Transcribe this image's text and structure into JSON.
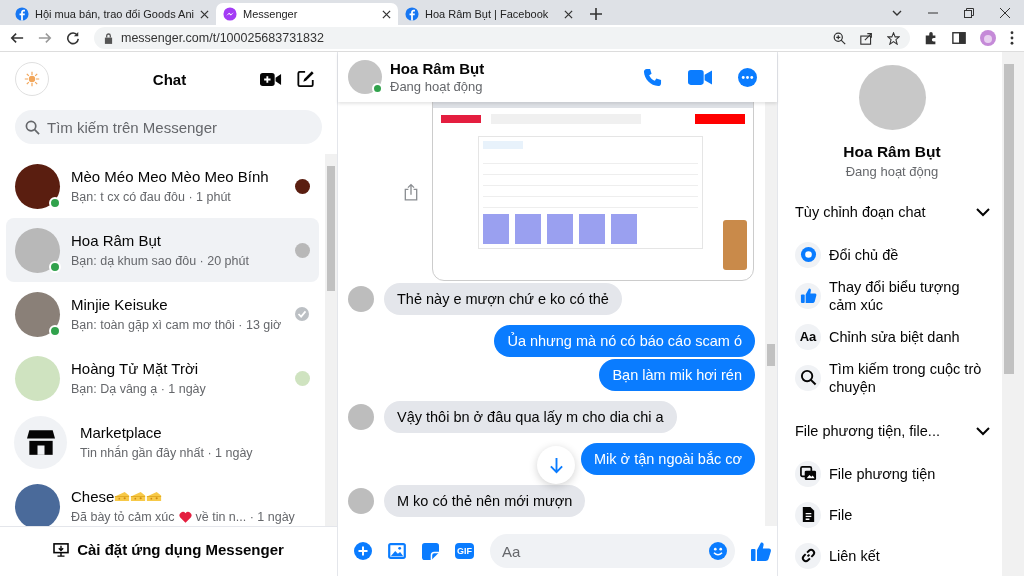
{
  "browser": {
    "tabs": [
      {
        "title": "Hội mua bán, trao đổi Goods Ani",
        "kind": "facebook",
        "selected": false
      },
      {
        "title": "Messenger",
        "kind": "messenger",
        "selected": true
      },
      {
        "title": "Hoa Râm Bụt | Facebook",
        "kind": "facebook",
        "selected": false
      }
    ],
    "address": "messenger.com/t/100025683731832"
  },
  "sidebar": {
    "title": "Chat",
    "search": {
      "placeholder": "Tìm kiếm trên Messenger"
    },
    "conversations": [
      {
        "kind": "person",
        "name": "Mèo Méo Meo Mèo Meo Bính",
        "snippet": "Bạn: t cx có đau đôu · 1 phút",
        "online": true,
        "selected": false,
        "receipt": {
          "kind": "avatar"
        },
        "color": "#5a1e10"
      },
      {
        "kind": "person",
        "name": "Hoa Râm Bụt",
        "snippet": "Bạn: dạ khum sao đôu · 20 phút",
        "online": true,
        "selected": true,
        "receipt": {
          "kind": "avatar"
        },
        "color": "#b8b8b8"
      },
      {
        "kind": "person",
        "name": "Minjie Keisuke",
        "snippet": "Bạn: toàn gặp xì cam mơ thôi · 13 giờ",
        "online": true,
        "selected": false,
        "receipt": {
          "kind": "check"
        },
        "color": "#8a8078"
      },
      {
        "kind": "person",
        "name": "Hoàng Tử Mặt Trời",
        "snippet": "Bạn: Dạ vâng ạ · 1 ngày",
        "online": false,
        "selected": false,
        "receipt": {
          "kind": "avatar"
        },
        "color": "#cfe3c0"
      },
      {
        "kind": "marketplace",
        "name": "Marketplace",
        "snippet": "Tin nhắn gần đây nhất · 1 ngày",
        "online": false,
        "selected": false
      },
      {
        "kind": "reaction",
        "name": "Chese",
        "snippet_start": "Đã bày tỏ cảm xúc",
        "snippet_end": "về tin n... · 1 ngày",
        "online": false,
        "selected": false,
        "color": "#4a6a9a"
      }
    ],
    "footer": "Cài đặt ứng dụng Messenger"
  },
  "chat": {
    "name": "Hoa Râm Bụt",
    "status": "Đang hoạt động",
    "online": true,
    "messages": [
      {
        "kind": "image"
      },
      {
        "kind": "incoming",
        "text": "Thẻ này e mượn chứ e ko có thẻ"
      },
      {
        "kind": "outgoing",
        "text": "Ủa nhưng mà nó có báo cáo scam ó"
      },
      {
        "kind": "outgoing",
        "text": "Bạn làm mik hơi rén"
      },
      {
        "kind": "incoming",
        "text": "Vậy thôi bn ở đâu qua lấy m cho dia chi a"
      },
      {
        "kind": "outgoing",
        "text": "Mik ở tận ngoài bắc cơ"
      },
      {
        "kind": "incoming",
        "text": "M ko có thẻ nên mới mượn"
      }
    ],
    "composer": {
      "placeholder": "Aa",
      "gif_label": "GIF"
    }
  },
  "details": {
    "name": "Hoa Râm Bụt",
    "status": "Đang hoạt động",
    "sections": [
      {
        "title": "Tùy chỉnh đoạn chat",
        "expanded": true,
        "items": [
          {
            "kind": "theme",
            "label": "Đổi chủ đề"
          },
          {
            "kind": "like",
            "label": "Thay đổi biểu tượng cảm xúc"
          },
          {
            "kind": "text",
            "icon_text": "Aa",
            "label": "Chỉnh sửa biệt danh"
          },
          {
            "kind": "search",
            "label": "Tìm kiếm trong cuộc trò chuyện"
          }
        ]
      },
      {
        "title": "File phương tiện, file...",
        "expanded": true,
        "items": [
          {
            "kind": "media",
            "label": "File phương tiện"
          },
          {
            "kind": "file",
            "label": "File"
          },
          {
            "kind": "link",
            "label": "Liên kết"
          }
        ]
      }
    ]
  }
}
